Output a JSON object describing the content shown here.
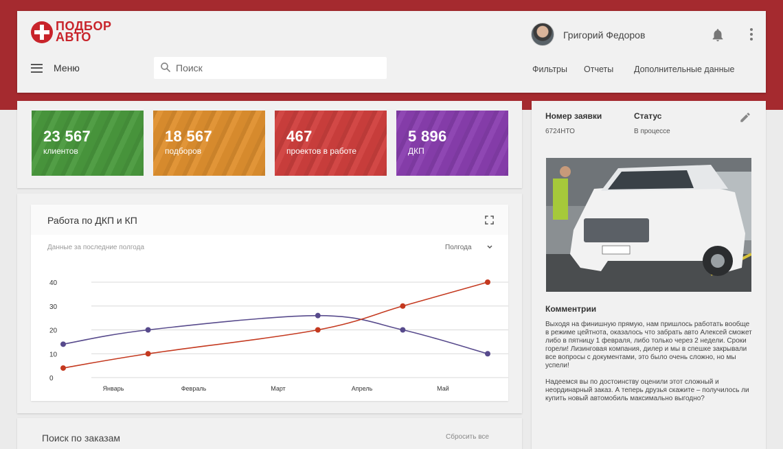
{
  "brand": {
    "line1": "ПОДБОР",
    "line2": "АВТО",
    "color": "#c8242b"
  },
  "header": {
    "user_name": "Григорий Федоров",
    "menu_label": "Меню",
    "search_placeholder": "Поиск",
    "nav": [
      "Фильтры",
      "Отчеты",
      "Дополнительные данные"
    ]
  },
  "stats": [
    {
      "value": "23 567",
      "label": "клиентов",
      "color": "#4a9a3e"
    },
    {
      "value": "18 567",
      "label": "подборов",
      "color": "#e0902f"
    },
    {
      "value": "467",
      "label": "проектов в работе",
      "color": "#d0403e"
    },
    {
      "value": "5 896",
      "label": "ДКП",
      "color": "#8a3fb0"
    }
  ],
  "chart_card": {
    "title": "Работа по ДКП и КП",
    "subtitle": "Данные за последние полгода",
    "period": "Полгода"
  },
  "chart_data": {
    "type": "line",
    "categories": [
      "Январь",
      "Февраль",
      "Март",
      "Апрель",
      "Май"
    ],
    "ylim": [
      0,
      40
    ],
    "yticks": [
      0,
      10,
      20,
      30,
      40
    ],
    "series": [
      {
        "color": "#574a8c",
        "x": [
          0,
          1,
          3,
          4,
          5
        ],
        "values": [
          14,
          20,
          26,
          20,
          10
        ]
      },
      {
        "color": "#c4391f",
        "x": [
          0,
          1,
          3,
          4,
          5
        ],
        "values": [
          4,
          10,
          20,
          30,
          40
        ]
      }
    ]
  },
  "order": {
    "number_label": "Номер заявки",
    "number_value": "6724НТО",
    "status_label": "Статус",
    "status_value": "В процессе",
    "comments_title": "Комментрии",
    "comment_p1": "Выходя на финишную прямую, нам пришлось работать вообще в режиме цейтнота, оказалось что забрать авто Алексей сможет либо в пятницу 1 февраля, либо только через 2 недели. Сроки горели! Лизинговая компания, дилер и мы в спешке закрывали все вопросы с документами, это было очень сложно, но мы успели!",
    "comment_p2": "Надеемся вы по достоинству оценили этот сложный и неординарный заказ. А теперь друзья скажите – получилось ли купить новый автомобиль максимально выгодно?"
  },
  "search_orders": {
    "title": "Поиск по заказам",
    "reset": "Сбросить все"
  }
}
